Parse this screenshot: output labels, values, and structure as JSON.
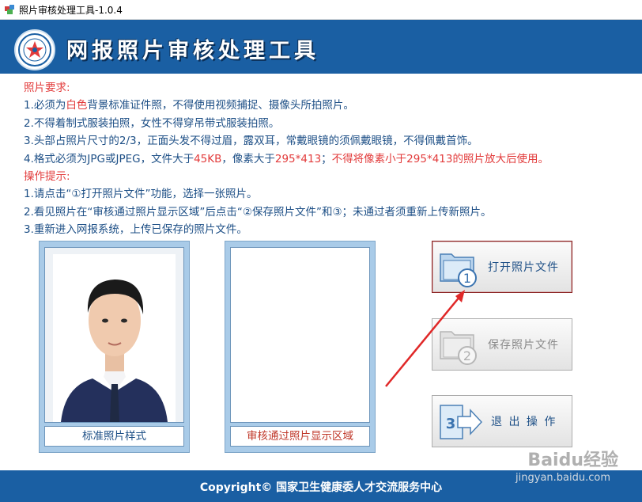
{
  "window": {
    "title": "照片审核处理工具-1.0.4"
  },
  "header": {
    "title": "网报照片审核处理工具"
  },
  "instructions": {
    "photo_requirements_heading": "照片要求:",
    "req1_a": "1.必须为",
    "req1_b": "白色",
    "req1_c": "背景标准证件照，不得使用视频捕捉、摄像头所拍照片。",
    "req2": "2.不得着制式服装拍照，女性不得穿吊带式服装拍照。",
    "req3": "3.头部占照片尺寸的2/3，正面头发不得过眉，露双耳，常戴眼镜的须佩戴眼镜，不得佩戴首饰。",
    "req4_a": "4.格式必须为JPG或JPEG，文件大于",
    "req4_b": "45KB",
    "req4_c": "，像素大于",
    "req4_d": "295*413",
    "req4_e": "；",
    "req4_f": "不得将像素小于295*413的照片放大后使用。",
    "ops_heading": "操作提示:",
    "op1": "1.请点击“①打开照片文件”功能，选择一张照片。",
    "op2": "2.看见照片在“审核通过照片显示区域”后点击“②保存照片文件”和③；未通过者须重新上传新照片。",
    "op3": "3.重新进入网报系统，上传已保存的照片文件。"
  },
  "sample_photo": {
    "caption": "标准照片样式"
  },
  "approved_area": {
    "caption": "审核通过照片显示区域"
  },
  "buttons": {
    "open": {
      "label": "打开照片文件",
      "number": "1"
    },
    "save": {
      "label": "保存照片文件",
      "number": "2"
    },
    "exit": {
      "label": "退 出 操 作",
      "number": "3"
    }
  },
  "footer": {
    "text": "Copyright©  国家卫生健康委人才交流服务中心"
  },
  "watermark": {
    "text": "Baidu经验",
    "url": "jingyan.baidu.com"
  },
  "colors": {
    "header_blue": "#1a5fa3",
    "text_blue": "#1d4f86",
    "highlight_red": "#e23a3a",
    "frame_blue": "#a9cbe8"
  }
}
